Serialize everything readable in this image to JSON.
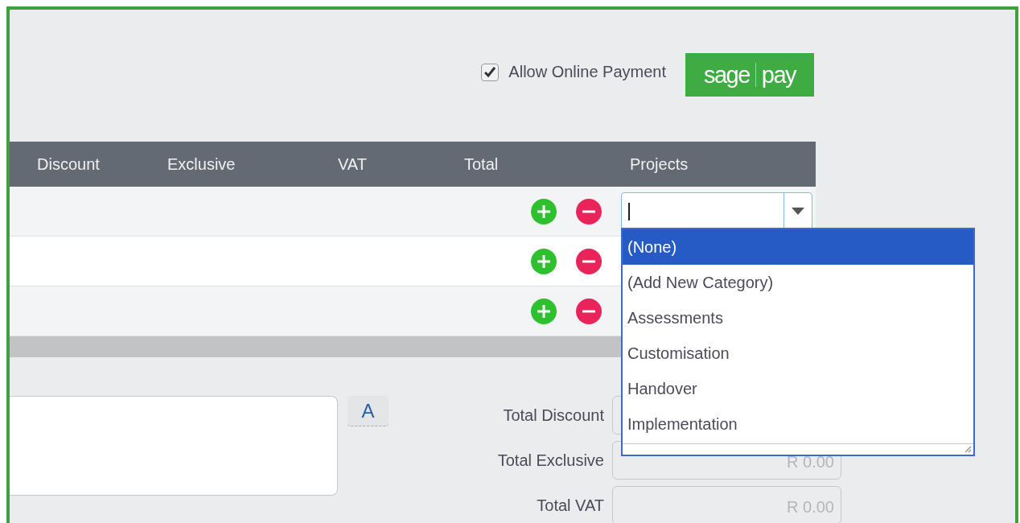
{
  "payment": {
    "allow_online": {
      "label": "Allow Online Payment",
      "checked": true
    },
    "logo": {
      "left": "sage",
      "right": "pay"
    }
  },
  "table": {
    "columns": [
      {
        "label": "Discount"
      },
      {
        "label": "Exclusive"
      },
      {
        "label": "VAT"
      },
      {
        "label": "Total"
      },
      {
        "label": "Projects"
      }
    ],
    "rows": [
      {
        "kind": "combo"
      },
      {
        "kind": "plain"
      },
      {
        "kind": "plain"
      }
    ]
  },
  "projects_dropdown": {
    "options": [
      {
        "label": "(None)",
        "selected": true
      },
      {
        "label": "(Add New Category)",
        "selected": false
      },
      {
        "label": "Assessments",
        "selected": false
      },
      {
        "label": "Customisation",
        "selected": false
      },
      {
        "label": "Handover",
        "selected": false
      },
      {
        "label": "Implementation",
        "selected": false
      }
    ]
  },
  "notes": {
    "format_button": "A"
  },
  "totals": [
    {
      "label": "Total Discount"
    },
    {
      "label": "Total Exclusive",
      "value": "R 0.00"
    },
    {
      "label": "Total VAT",
      "value": "R 0.00"
    }
  ]
}
